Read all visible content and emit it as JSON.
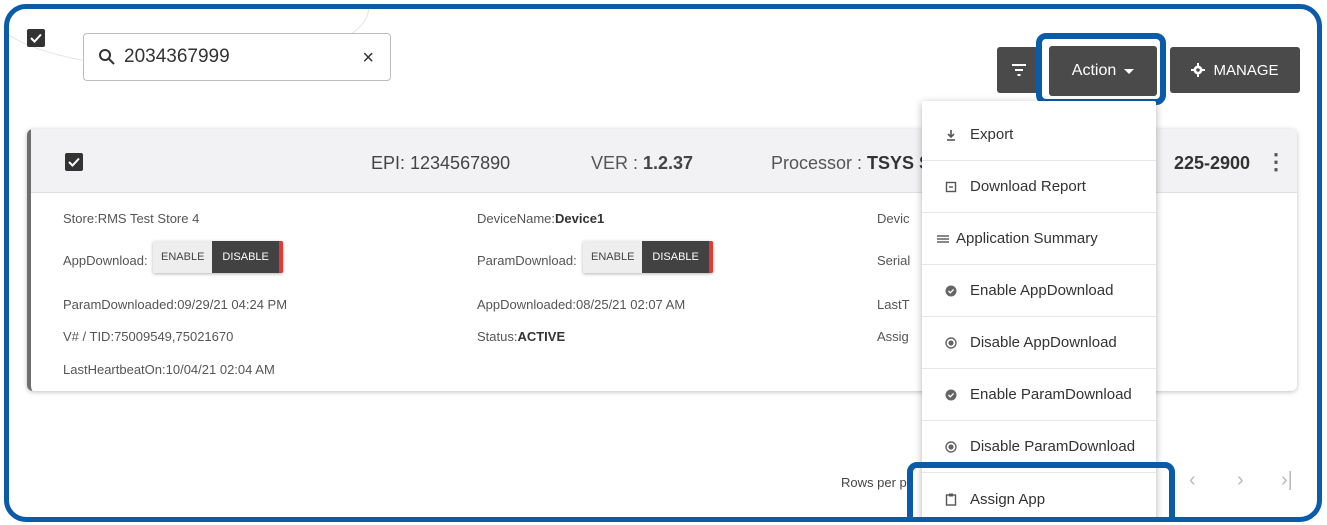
{
  "search": {
    "value": "2034367999",
    "clear_glyph": "×"
  },
  "toolbar": {
    "filter_icon": "filter-icon",
    "action_label": "Action",
    "manage_label": "MANAGE"
  },
  "device_card": {
    "epi": "EPI: 1234567890",
    "ver_label": "VER : ",
    "ver_value": "1.2.37",
    "processor_label": "Processor : ",
    "processor_value": "TSYS SI",
    "phone_partial": "225-2900",
    "store_label": "Store:",
    "store_value": "RMS Test Store 4",
    "device_name_label": "DeviceName:",
    "device_name_value": "Device1",
    "app_download_label": "AppDownload:",
    "param_download_label": "ParamDownload:",
    "enable_label": "ENABLE",
    "disable_label": "DISABLE",
    "param_downloaded_label": "ParamDownloaded:",
    "param_downloaded_value": "09/29/21 04:24 PM",
    "app_downloaded_label": "AppDownloaded:",
    "app_downloaded_value": "08/25/21 02:07 AM",
    "vtid_label": "V# / TID:",
    "vtid_value": "75009549,75021670",
    "status_label": "Status:",
    "status_value": "ACTIVE",
    "last_heartbeat_label": "LastHeartbeatOn:",
    "last_heartbeat_value": "10/04/21 02:04 AM",
    "col3_row1": "Devic",
    "col3_row2": "Serial",
    "col3_row3": "LastT",
    "col3_row4": "Assig"
  },
  "action_menu": {
    "items": [
      {
        "label": "Export",
        "icon": "download-icon"
      },
      {
        "label": "Download Report",
        "icon": "report-icon"
      },
      {
        "label": "Application Summary",
        "icon": "list-icon"
      },
      {
        "label": "Enable AppDownload",
        "icon": "check-circle-icon"
      },
      {
        "label": "Disable AppDownload",
        "icon": "radio-circle-icon"
      },
      {
        "label": "Enable ParamDownload",
        "icon": "check-circle-icon"
      },
      {
        "label": "Disable ParamDownload",
        "icon": "radio-circle-icon"
      },
      {
        "label": "Assign App",
        "icon": "clipboard-icon"
      }
    ]
  },
  "pagination": {
    "rows_per_page_partial": "Rows per p"
  },
  "colors": {
    "highlight": "#0a5ca8",
    "button_bg": "#4a4a4a",
    "disable_accent": "#e53935"
  }
}
